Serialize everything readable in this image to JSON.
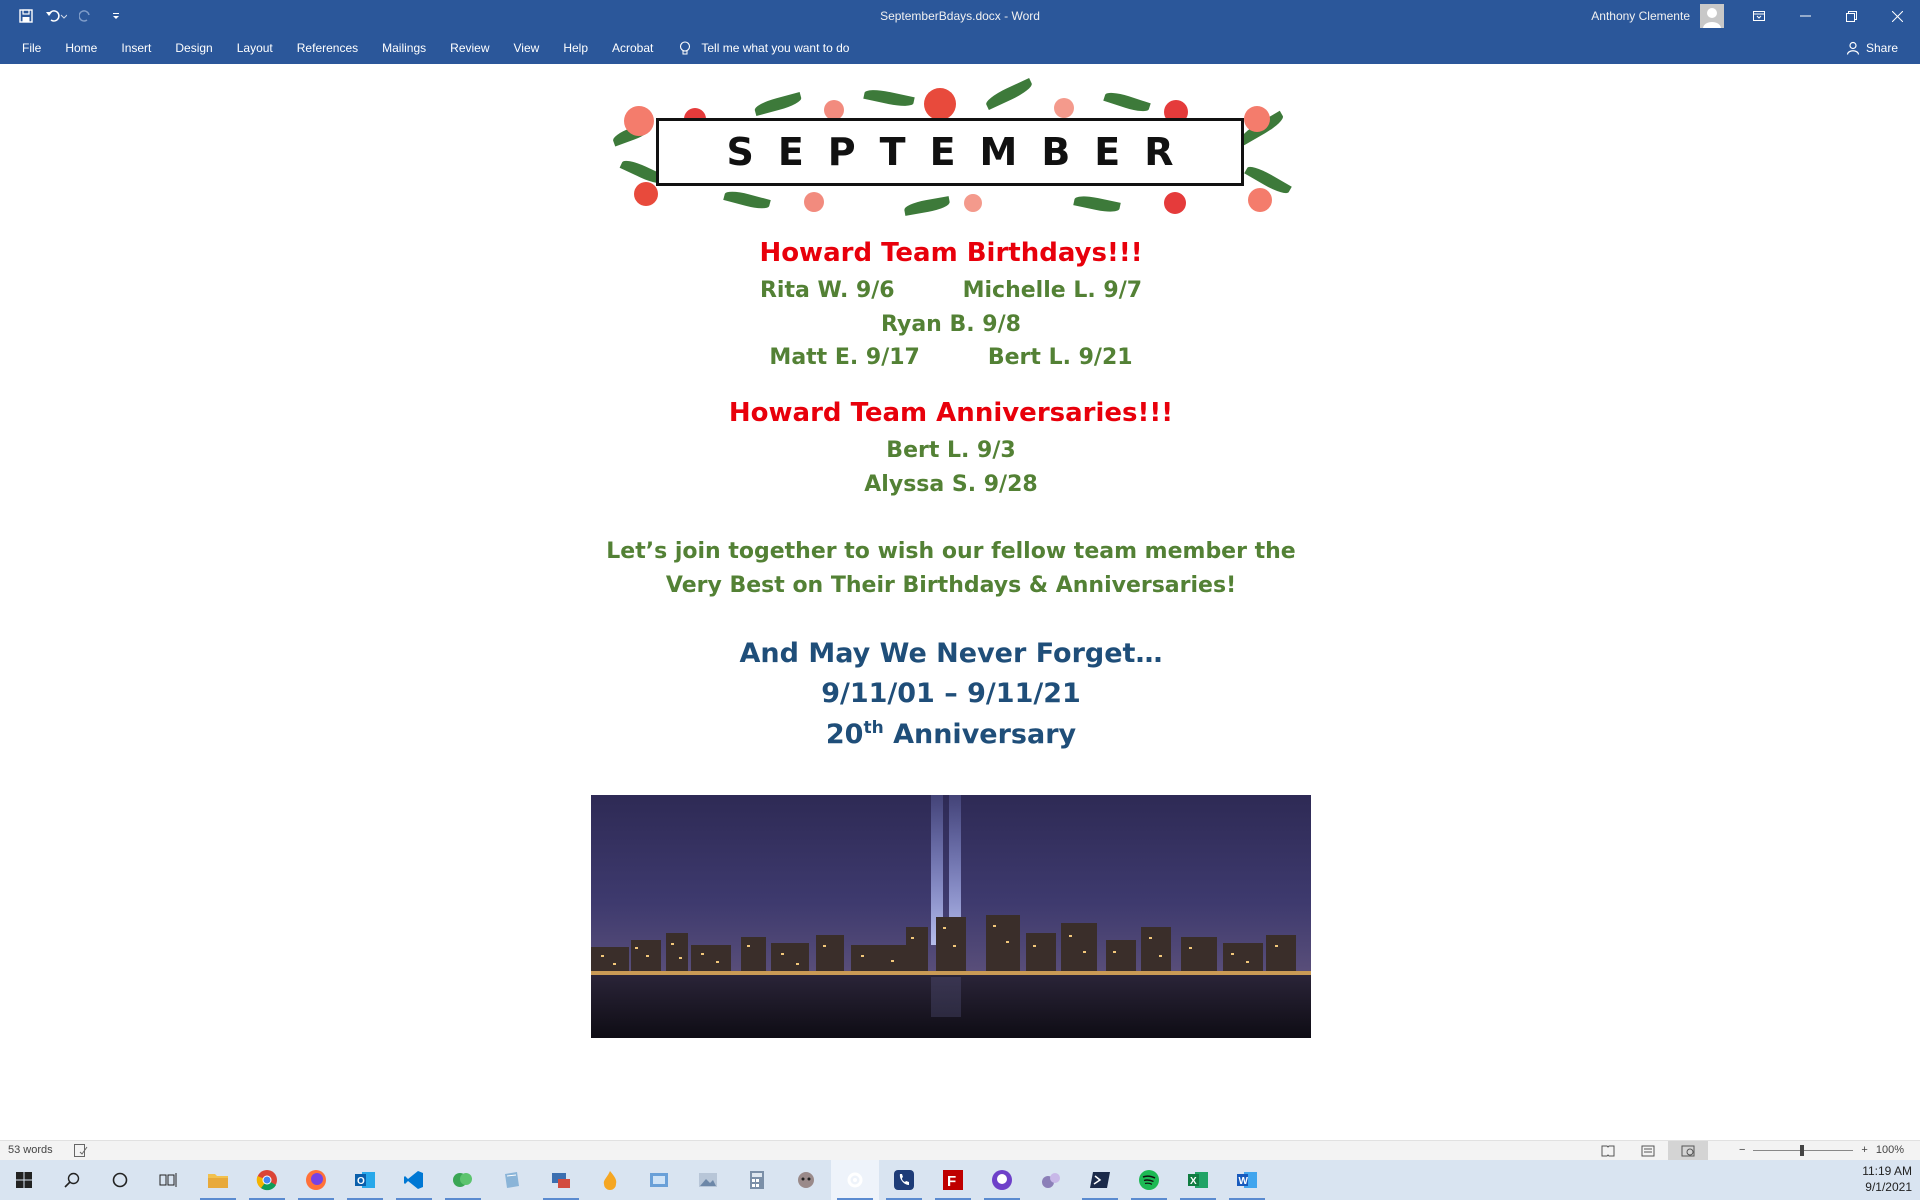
{
  "titlebar": {
    "doc_title": "SeptemberBdays.docx  -  Word",
    "account_name": "Anthony Clemente"
  },
  "ribbon": {
    "tabs": [
      "File",
      "Home",
      "Insert",
      "Design",
      "Layout",
      "References",
      "Mailings",
      "Review",
      "View",
      "Help",
      "Acrobat"
    ],
    "tell_me": "Tell me what you want to do",
    "share": "Share"
  },
  "document": {
    "banner": "SEPTEMBER",
    "birthdays_heading": "Howard Team Birthdays!!!",
    "birthdays": [
      "Rita W. 9/6",
      "Michelle L. 9/7",
      "Ryan B. 9/8",
      "Matt E. 9/17",
      "Bert L. 9/21"
    ],
    "anniversaries_heading": "Howard Team Anniversaries!!!",
    "anniversaries": [
      "Bert L. 9/3",
      "Alyssa S. 9/28"
    ],
    "message_line1": "Let’s join together to wish our fellow team member the",
    "message_line2": "Very Best on Their Birthdays & Anniversaries!",
    "memorial_line1": "And May We Never Forget…",
    "memorial_line2": "9/11/01 – 9/11/21",
    "memorial_num": "20",
    "memorial_sup": "th",
    "memorial_word": "Anniversary"
  },
  "statusbar": {
    "words": "53 words",
    "zoom": "100%"
  },
  "taskbar": {
    "time": "11:19 AM",
    "date": "9/1/2021"
  },
  "colors": {
    "word_blue": "#2b579a",
    "heading_red": "#e8000b",
    "name_green": "#538135",
    "memorial_blue": "#1f4e79"
  }
}
